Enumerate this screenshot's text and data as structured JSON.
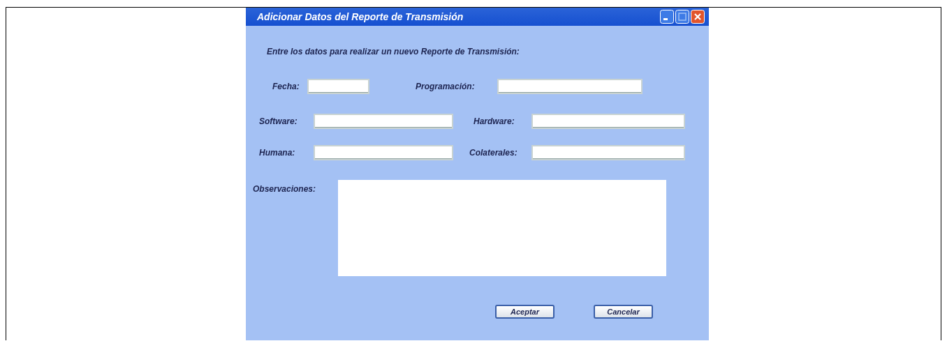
{
  "window": {
    "title": "Adicionar Datos del Reporte de Transmisión"
  },
  "intro": "Entre los datos para realizar un nuevo Reporte de Transmisión:",
  "rows": [
    [
      {
        "label": "Fecha:"
      },
      {
        "label": "Programación:"
      }
    ],
    [
      {
        "label": "Software:"
      },
      {
        "label": "Hardware:"
      }
    ],
    [
      {
        "label": "Humana:"
      },
      {
        "label": "Colaterales:"
      }
    ]
  ],
  "observations": {
    "label": "Observaciones:"
  },
  "buttons": [
    "Aceptar",
    "Cancelar"
  ]
}
